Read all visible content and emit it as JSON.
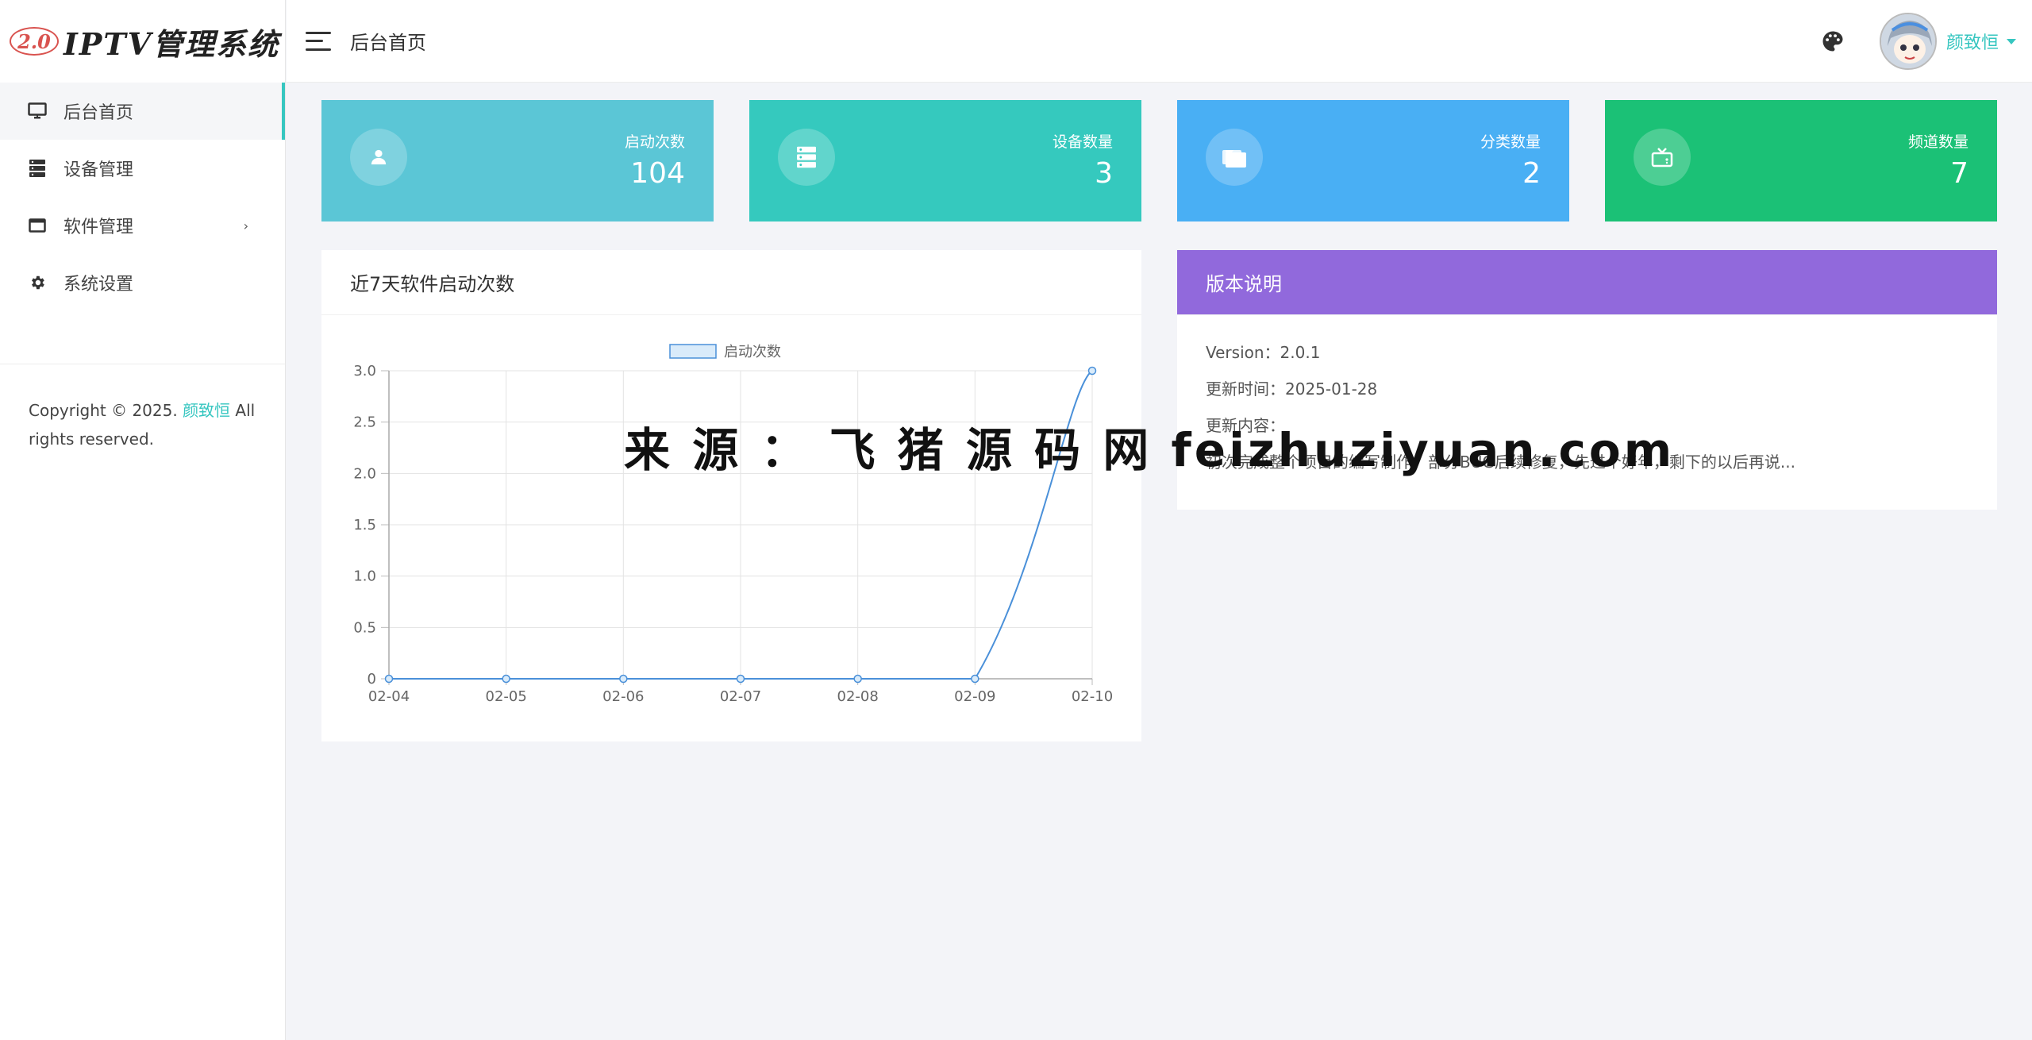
{
  "sidebar": {
    "logo_badge": "2.0",
    "logo_text": "IPTV管理系统",
    "items": [
      {
        "label": "后台首页",
        "icon": "monitor-icon",
        "active": true
      },
      {
        "label": "设备管理",
        "icon": "server-icon",
        "active": false
      },
      {
        "label": "软件管理",
        "icon": "window-icon",
        "active": false,
        "has_children": true
      },
      {
        "label": "系统设置",
        "icon": "gear-icon",
        "active": false
      }
    ],
    "arrow": "›",
    "copyright_prefix": "Copyright © 2025.",
    "copyright_author": "颜致恒",
    "copyright_suffix": "All rights reserved."
  },
  "header": {
    "title": "后台首页",
    "user_name": "颜致恒"
  },
  "stats": [
    {
      "label": "启动次数",
      "value": "104",
      "color": "#5bc6d6",
      "icon": "user-icon"
    },
    {
      "label": "设备数量",
      "value": "3",
      "color": "#35c9be",
      "icon": "server-icon"
    },
    {
      "label": "分类数量",
      "value": "2",
      "color": "#49aff4",
      "icon": "folder-icon"
    },
    {
      "label": "频道数量",
      "value": "7",
      "color": "#1bc176",
      "icon": "tv-icon"
    }
  ],
  "chart_panel": {
    "title": "近7天软件启动次数"
  },
  "chart_data": {
    "type": "line",
    "categories": [
      "02-04",
      "02-05",
      "02-06",
      "02-07",
      "02-08",
      "02-09",
      "02-10"
    ],
    "series": [
      {
        "name": "启动次数",
        "values": [
          0,
          0,
          0,
          0,
          0,
          0,
          3
        ]
      }
    ],
    "ylim": [
      0,
      3.0
    ],
    "yticks": [
      "0",
      "0.5",
      "1.0",
      "1.5",
      "2.0",
      "2.5",
      "3.0"
    ],
    "grid": true,
    "legend": "top-center",
    "line_color": "#4a90d9"
  },
  "version_panel": {
    "title": "版本说明",
    "header_color": "#9169dc",
    "version_label": "Version：2.0.1",
    "update_time": "更新时间：2025-01-28",
    "content_label": "更新内容：",
    "content_text": "初次完成整个项目的编写制作。部分BUG后续修复，先过个好年，剩下的以后再说..."
  },
  "watermark": "来 源 ： 飞 猪 源 码 网 feizhuziyuan.com"
}
